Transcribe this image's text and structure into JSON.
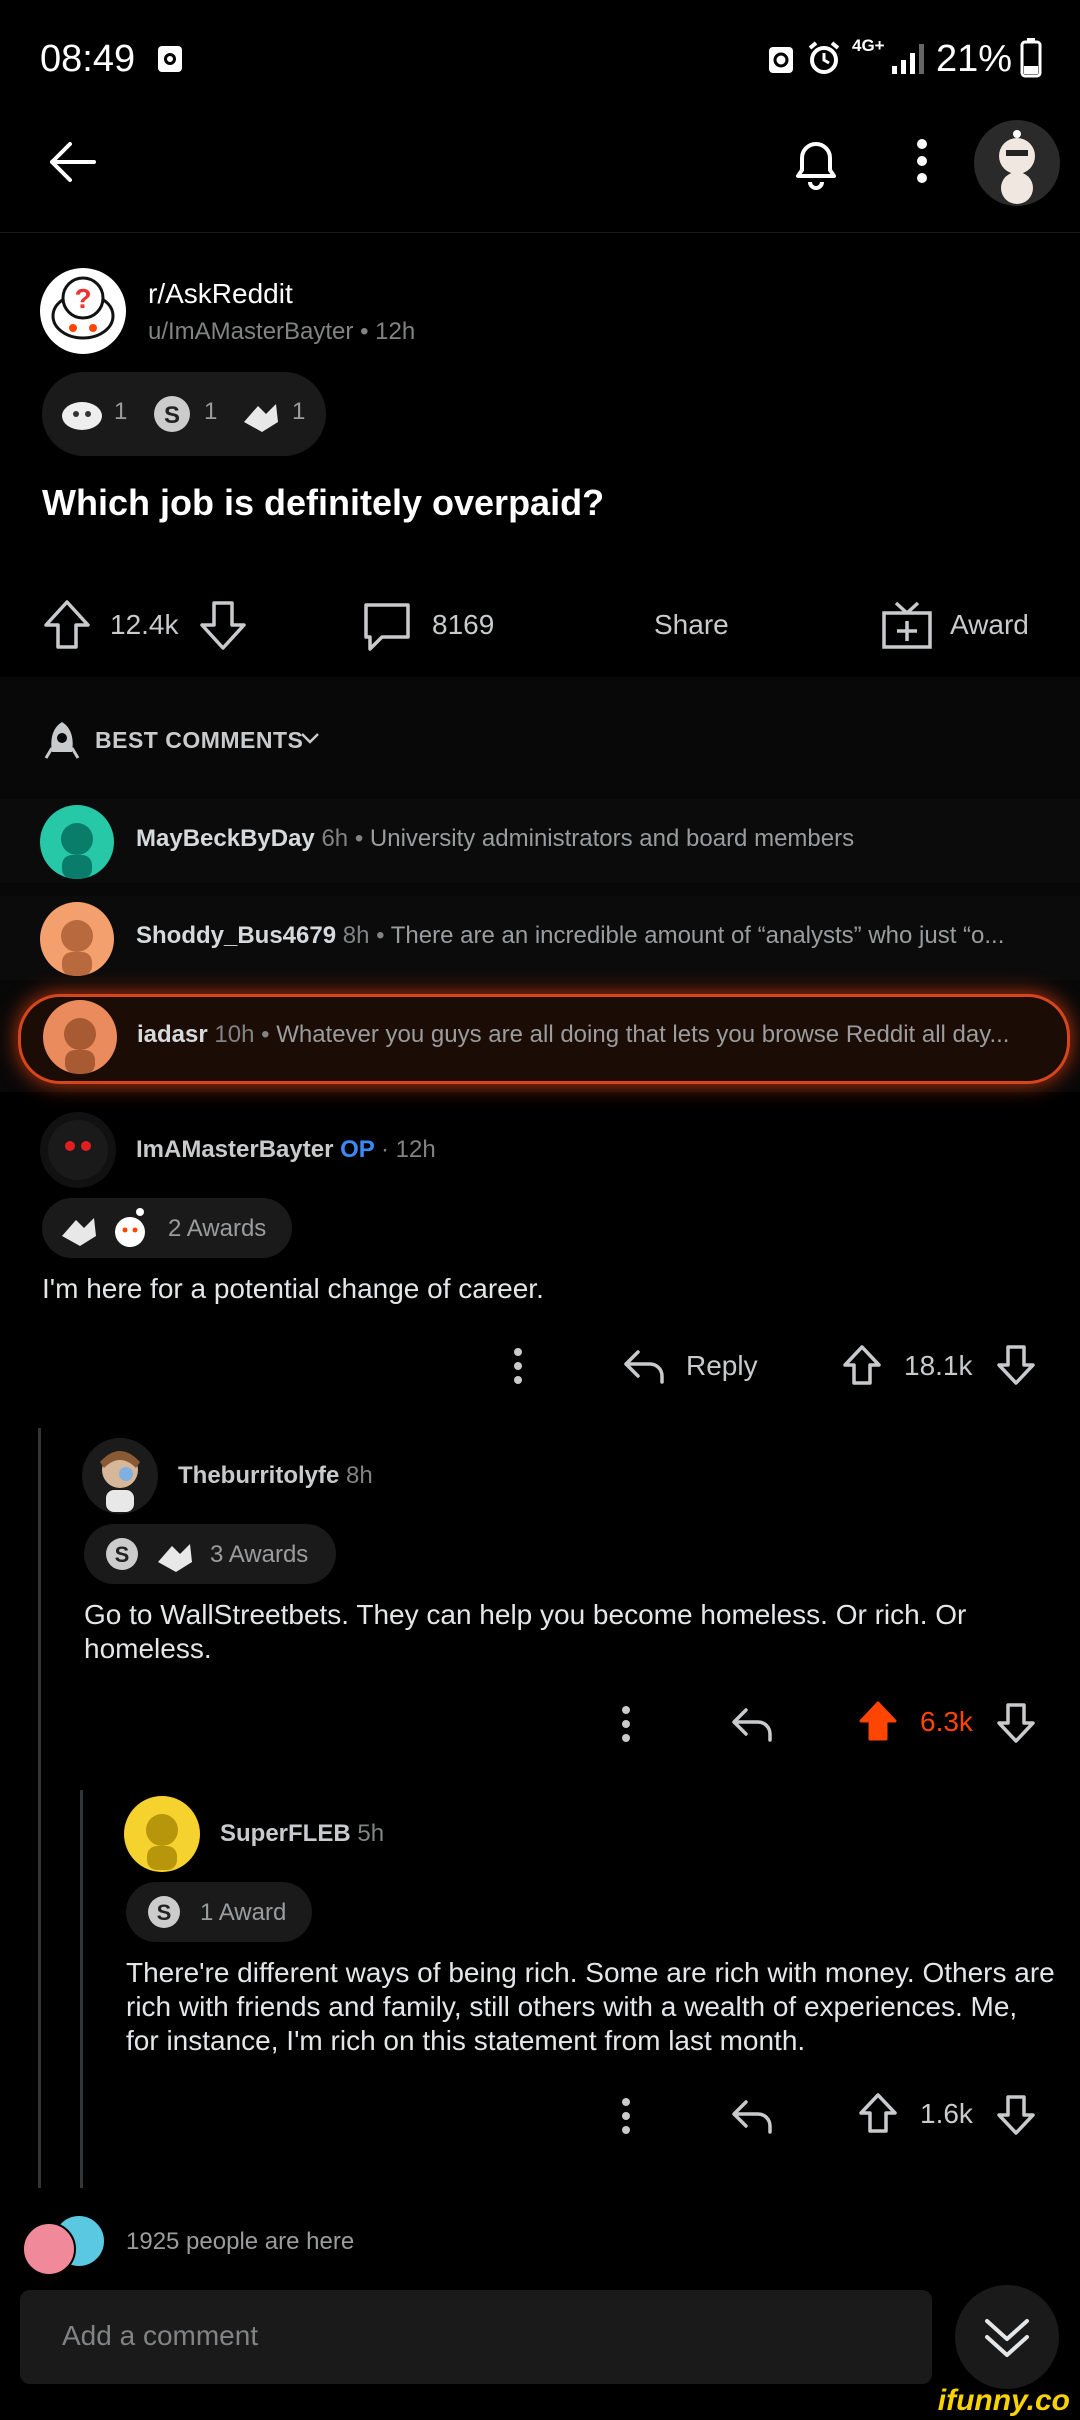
{
  "status_bar": {
    "time": "08:49",
    "battery": "21%",
    "network": "4G+"
  },
  "post": {
    "subreddit": "r/AskReddit",
    "author": "u/ImAMasterBayter",
    "age": "12h",
    "meta": "u/ImAMasterBayter • 12h",
    "awards": [
      {
        "icon": "wholesome-award-icon",
        "count": "1"
      },
      {
        "icon": "silver-award-icon",
        "count": "1"
      },
      {
        "icon": "helpful-award-icon",
        "count": "1"
      }
    ],
    "title": "Which job is definitely overpaid?",
    "score": "12.4k",
    "comment_count": "8169",
    "share_label": "Share",
    "award_label": "Award"
  },
  "best_comments": {
    "label": "BEST COMMENTS",
    "previews": [
      {
        "user": "MayBeckByDay",
        "age": "6h",
        "text": "University administrators and board members",
        "avatar_color": "#26c8a8"
      },
      {
        "user": "Shoddy_Bus4679",
        "age": "8h",
        "text": "There are an incredible amount of “analysts” who just “o...",
        "avatar_color": "#f4a06e"
      },
      {
        "user": "iadasr",
        "age": "10h",
        "text": "Whatever you guys are all doing that lets you browse Reddit all day...",
        "avatar_color": "#e98b5c"
      }
    ]
  },
  "comments": [
    {
      "user": "ImAMasterBayter",
      "op_tag": "OP",
      "age": "· 12h",
      "awards_text": "2 Awards",
      "body": "I'm here for a potential change of career.",
      "reply_label": "Reply",
      "score": "18.1k"
    },
    {
      "user": "Theburritolyfe",
      "age": "8h",
      "awards_text": "3 Awards",
      "body": "Go to WallStreetbets. They can help you become homeless. Or rich.  Or homeless.",
      "score": "6.3k",
      "upvoted": true
    },
    {
      "user": "SuperFLEB",
      "age": "5h",
      "awards_text": "1 Award",
      "body": "There're different ways of being rich. Some are rich with money. Others are rich with friends and family, still others with a wealth of experiences. Me, for instance, I'm rich on this statement from last month.",
      "score": "1.6k"
    }
  ],
  "footer": {
    "people_here": "1925 people are here",
    "comment_placeholder": "Add a comment",
    "watermark": "ifunny.co"
  },
  "colors": {
    "background": "#000000",
    "upvote_active": "#ff4500",
    "op_blue": "#3d8af7"
  }
}
